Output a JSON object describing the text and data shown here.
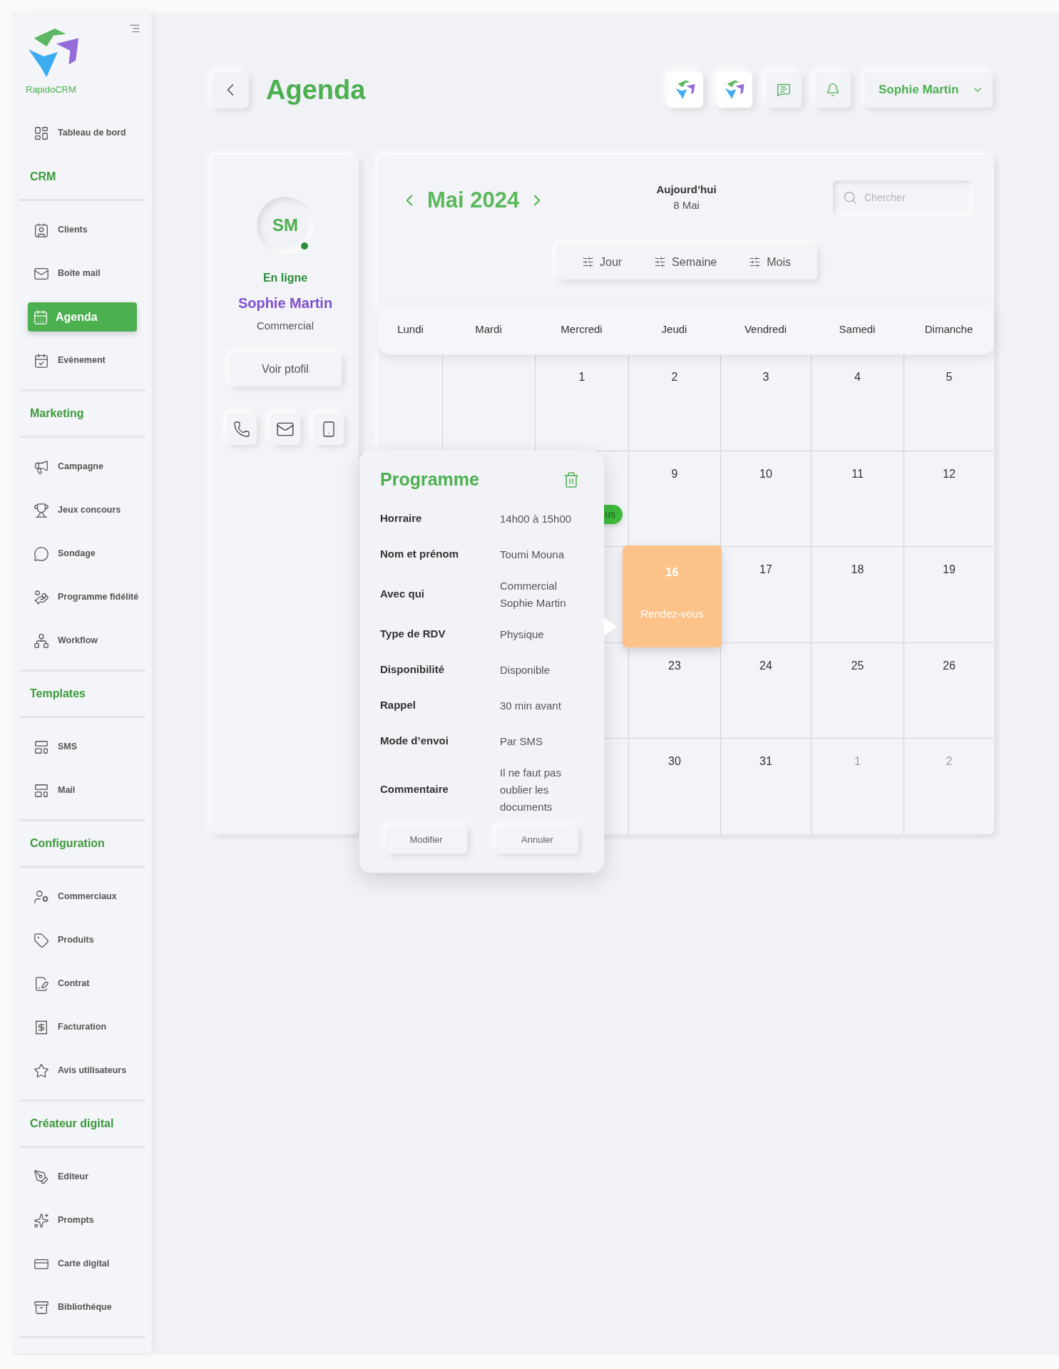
{
  "sidebar": {
    "brand": "RapidoCRM",
    "sections": [
      {
        "items": [
          {
            "label": "Tableau de bord",
            "selected": false
          }
        ]
      },
      {
        "title": "CRM",
        "items": [
          {
            "label": "Clients",
            "selected": false
          },
          {
            "label": "Boite mail",
            "selected": false
          },
          {
            "label": "Agenda",
            "selected": true
          },
          {
            "label": "Evènement",
            "selected": false
          }
        ]
      },
      {
        "title": "Marketing",
        "items": [
          {
            "label": "Campagne",
            "selected": false
          },
          {
            "label": "Jeux concours",
            "selected": false
          },
          {
            "label": "Sondage",
            "selected": false
          },
          {
            "label": "Programme fidélité",
            "selected": false
          },
          {
            "label": "Workflow",
            "selected": false
          }
        ]
      },
      {
        "title": "Templates",
        "items": [
          {
            "label": "SMS",
            "selected": false
          },
          {
            "label": "Mail",
            "selected": false
          }
        ]
      },
      {
        "title": "Configuration",
        "items": [
          {
            "label": "Commerciaux",
            "selected": false
          },
          {
            "label": "Produits",
            "selected": false
          },
          {
            "label": "Contrat",
            "selected": false
          },
          {
            "label": "Facturation",
            "selected": false
          },
          {
            "label": "Avis utilisateurs",
            "selected": false
          }
        ]
      },
      {
        "title": "Créateur digital",
        "items": [
          {
            "label": "Editeur",
            "selected": false
          },
          {
            "label": "Prompts",
            "selected": false
          },
          {
            "label": "Carte digital",
            "selected": false
          },
          {
            "label": "Bibliothéque",
            "selected": false
          }
        ]
      }
    ]
  },
  "header": {
    "title": "Agenda",
    "user": "Sophie Martin"
  },
  "profile": {
    "initials": "SM",
    "online": true,
    "status": "En ligne",
    "name": "Sophie Martin",
    "role": "Commercial",
    "button": "Voir ptofil"
  },
  "calendar": {
    "month": "Mai 2024",
    "today_label": "Aujourd’hui",
    "today_date": "8 Mai",
    "search": {
      "placeholder": "Chercher"
    },
    "views": [
      "Jour",
      "Semaine",
      "Mois"
    ],
    "weekdays": [
      "Lundi",
      "Mardi",
      "Mercredi",
      "Jeudi",
      "Vendredi",
      "Samedi",
      "Dimanche"
    ],
    "weeks": [
      [
        {
          "kind": "blank"
        },
        {
          "kind": "blank"
        },
        {
          "kind": "day",
          "day": "1"
        },
        {
          "kind": "day",
          "day": "2"
        },
        {
          "kind": "day",
          "day": "3"
        },
        {
          "kind": "day",
          "day": "4"
        },
        {
          "kind": "day",
          "day": "5"
        }
      ],
      [
        {
          "kind": "blank"
        },
        {
          "kind": "blank"
        },
        {
          "kind": "event-pill",
          "event": "us"
        },
        {
          "kind": "day",
          "day": "9"
        },
        {
          "kind": "day",
          "day": "10"
        },
        {
          "kind": "day",
          "day": "11"
        },
        {
          "kind": "day",
          "day": "12"
        }
      ],
      [
        {
          "kind": "blank"
        },
        {
          "kind": "blank"
        },
        {
          "kind": "blank"
        },
        {
          "kind": "appointment",
          "day": "16",
          "event": "Rendez-vous"
        },
        {
          "kind": "day",
          "day": "17"
        },
        {
          "kind": "day",
          "day": "18"
        },
        {
          "kind": "day",
          "day": "19"
        }
      ],
      [
        {
          "kind": "blank"
        },
        {
          "kind": "blank"
        },
        {
          "kind": "blank"
        },
        {
          "kind": "day",
          "day": "23"
        },
        {
          "kind": "day",
          "day": "24"
        },
        {
          "kind": "day",
          "day": "25"
        },
        {
          "kind": "day",
          "day": "26"
        }
      ],
      [
        {
          "kind": "blank"
        },
        {
          "kind": "blank"
        },
        {
          "kind": "blank"
        },
        {
          "kind": "day",
          "day": "30"
        },
        {
          "kind": "day",
          "day": "31"
        },
        {
          "kind": "other-month",
          "day": "1"
        },
        {
          "kind": "other-month",
          "day": "2"
        }
      ]
    ]
  },
  "popup": {
    "title": "Programme",
    "fields": [
      {
        "label": "Horraire",
        "value": "14h00 à 15h00"
      },
      {
        "label": "Nom et prénom",
        "value": "Toumi Mouna"
      },
      {
        "label": "Avec qui",
        "value": "Commercial\nSophie Martin"
      },
      {
        "label": "Type de RDV",
        "value": "Physique"
      },
      {
        "label": "Disponibilité",
        "value": "Disponible"
      },
      {
        "label": "Rappel",
        "value": "30 min avant"
      },
      {
        "label": "Mode d’envoi",
        "value": "Par SMS"
      },
      {
        "label": "Commentaire",
        "value": "Il ne faut pas\n oublier les\ndocuments"
      }
    ],
    "buttons": [
      "Modifier",
      "Annuler"
    ]
  }
}
